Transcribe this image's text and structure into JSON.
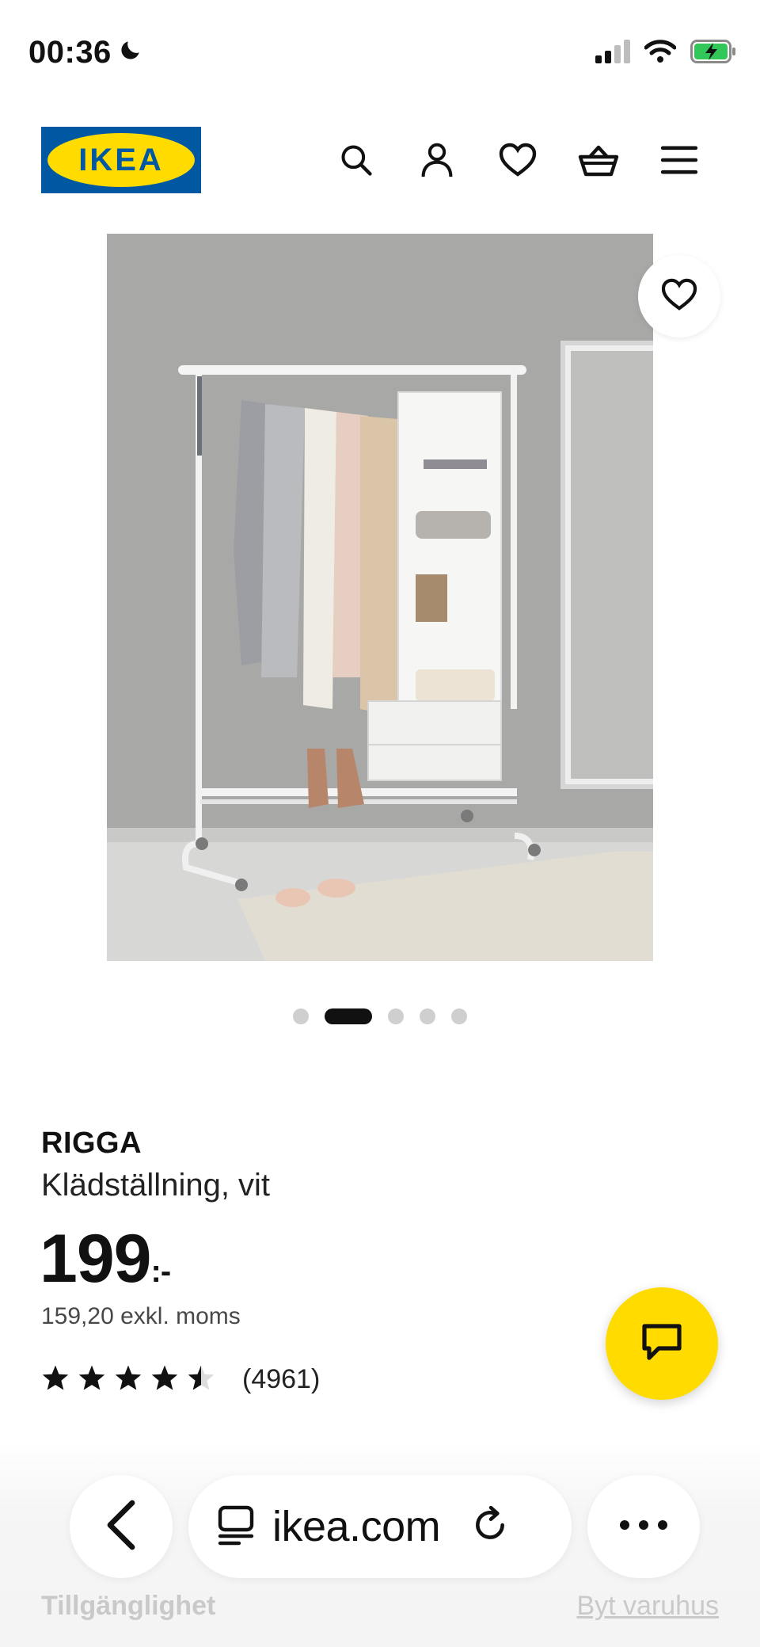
{
  "status_bar": {
    "time": "00:36"
  },
  "header": {
    "logo_text": "IKEA",
    "icons": [
      "search-icon",
      "account-icon",
      "heart-icon",
      "basket-icon",
      "menu-icon"
    ]
  },
  "gallery": {
    "dot_count": 5,
    "active_index": 1
  },
  "product": {
    "name": "RIGGA",
    "description": "Klädställning, vit",
    "price_main": "199",
    "price_suffix": ":-",
    "price_excl": "159,20 exkl. moms",
    "rating": 4.5,
    "rating_max": 5,
    "review_count": "(4961)"
  },
  "browser": {
    "url": "ikea.com"
  },
  "footer": {
    "accessibility": "Tillgänglighet",
    "change_store": "Byt varuhus"
  },
  "colors": {
    "ikea_blue": "#0058a3",
    "ikea_yellow": "#ffdb00"
  }
}
